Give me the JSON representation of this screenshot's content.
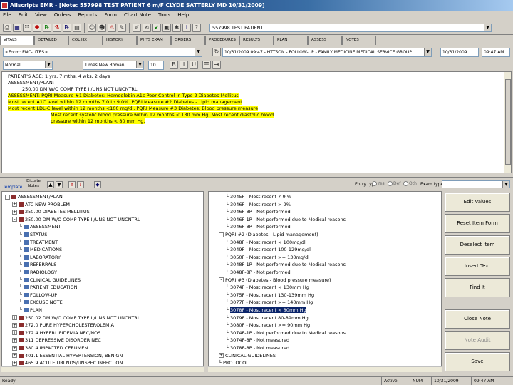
{
  "window": {
    "title": "Allscripts EMR - [Note: 557998 TEST PATIENT 6 m/F CLYDE SATTERLY MD 10/31/2009]"
  },
  "menu": [
    "File",
    "Edit",
    "View",
    "Orders",
    "Reports",
    "Form",
    "Chart Note",
    "Tools",
    "Help"
  ],
  "toolbar": {
    "patient_value": "557998 TEST PATIENT"
  },
  "tabs": [
    "VITALS",
    "DETAILED",
    "COL HX",
    "HISTORY",
    "PHYS EXAM",
    "ORDERS",
    "PROCEDURES",
    "RESULTS",
    "PLAN",
    "ASSESS",
    "NOTES"
  ],
  "note_header": {
    "form_value": "<Form: ENC-LITES>",
    "visit_value": "10/31/2009 09:47 - HTTSON - FOLLOW-UP - FAMILY MEDICINE MEDICAL SERVICE GROUP",
    "date_value": "10/31/2009",
    "time_value": "09:47 AM"
  },
  "format_bar": {
    "style_value": "Normal",
    "font_value": "Times New Roman",
    "size_value": "10"
  },
  "note_text": [
    {
      "text": "PATIENT'S AGE: 1 yrs, 7 mths, 4 wks, 2 days",
      "hl": false,
      "indent": 0
    },
    {
      "text": "ASSESSMENT/PLAN:",
      "hl": false,
      "indent": 0
    },
    {
      "text": "250.00 DM W/O COMP TYPE II/UNS NOT UNCNTRL",
      "hl": false,
      "indent": 20
    },
    {
      "text": "ASSESSMENT: PQRI Measure #1 Diabetes: Hemoglobin A1c Poor Control in Type 2 Diabetes Mellitus",
      "hl": true,
      "indent": 0
    },
    {
      "text": "Most recent A1C level within 12 months 7.0 to 9.0%. PQRI Measure #2 Diabetes - Lipid management",
      "hl": true,
      "indent": 0
    },
    {
      "text": "Most recent LDL-C level within 12 months <100 mg/dl. PQRI Measure #3 Diabetes: Blood pressure measure",
      "hl": true,
      "indent": 0
    },
    {
      "text": "Most recent systolic blood pressure within 12 months < 130 mm Hg. Most recent diastolic blood",
      "hl": true,
      "indent": 60
    },
    {
      "text": "pressure within 12 months < 80 mm Hg.",
      "hl": true,
      "indent": 60
    }
  ],
  "midbar": {
    "tab_templates": "Template",
    "tab_dictate": "Dictate Notes",
    "entry_type_label": "Entry type",
    "radio_1": "Yes",
    "radio_2": "Def",
    "radio_3": "Oth",
    "exam_label": "Exam type"
  },
  "left_tree": [
    {
      "text": "ASSESSMENT/PLAN",
      "level": 0,
      "exp": "-",
      "icon": "folder"
    },
    {
      "text": "ATC NEW PROBLEM",
      "level": 1,
      "exp": "+",
      "icon": "folder"
    },
    {
      "text": "250.00 DIABETES MELLITUS",
      "level": 1,
      "exp": "+",
      "icon": "folder"
    },
    {
      "text": "250.00 DM W/O COMP TYPE II/UNS NOT UNCNTRL",
      "level": 1,
      "exp": "-",
      "icon": "folder"
    },
    {
      "text": "ASSESSMENT",
      "level": 2,
      "exp": "",
      "icon": "doc"
    },
    {
      "text": "STATUS",
      "level": 2,
      "exp": "",
      "icon": "doc"
    },
    {
      "text": "TREATMENT",
      "level": 2,
      "exp": "",
      "icon": "doc"
    },
    {
      "text": "MEDICATIONS",
      "level": 2,
      "exp": "",
      "icon": "doc"
    },
    {
      "text": "LABORATORY",
      "level": 2,
      "exp": "",
      "icon": "doc"
    },
    {
      "text": "REFERRALS",
      "level": 2,
      "exp": "",
      "icon": "doc"
    },
    {
      "text": "RADIOLOGY",
      "level": 2,
      "exp": "",
      "icon": "doc"
    },
    {
      "text": "CLINICAL GUIDELINES",
      "level": 2,
      "exp": "",
      "icon": "doc"
    },
    {
      "text": "PATIENT EDUCATION",
      "level": 2,
      "exp": "",
      "icon": "doc"
    },
    {
      "text": "FOLLOW-UP",
      "level": 2,
      "exp": "",
      "icon": "doc"
    },
    {
      "text": "EXCUSE NOTE",
      "level": 2,
      "exp": "",
      "icon": "doc"
    },
    {
      "text": "PLAN",
      "level": 2,
      "exp": "",
      "icon": "doc"
    },
    {
      "text": "250.02 DM W/O COMP TYPE II/UNS NOT UNCNTRL",
      "level": 1,
      "exp": "+",
      "icon": "folder"
    },
    {
      "text": "272.0 PURE HYPERCHOLESTEROLEMIA",
      "level": 1,
      "exp": "+",
      "icon": "folder"
    },
    {
      "text": "272.4 HYPERLIPIDEMIA NEC/NOS",
      "level": 1,
      "exp": "+",
      "icon": "folder"
    },
    {
      "text": "311 DEPRESSIVE DISORDER NEC",
      "level": 1,
      "exp": "+",
      "icon": "folder"
    },
    {
      "text": "380.4 IMPACTED CERUMEN",
      "level": 1,
      "exp": "+",
      "icon": "folder"
    },
    {
      "text": "401.1 ESSENTIAL HYPERTENSION, BENIGN",
      "level": 1,
      "exp": "+",
      "icon": "folder"
    },
    {
      "text": "465.9 ACUTE URI NOS/UNSPEC INFECTION",
      "level": 1,
      "exp": "+",
      "icon": "folder"
    }
  ],
  "mid_tree": [
    {
      "text": "3045F - Most recent 7-9 %",
      "level": 2,
      "exp": "",
      "sel": false
    },
    {
      "text": "3046F - Most recent > 9%",
      "level": 2,
      "exp": "",
      "sel": false
    },
    {
      "text": "3046F-8P - Not performed",
      "level": 2,
      "exp": "",
      "sel": false
    },
    {
      "text": "3046F-1P - Not performed due to Medical reasons",
      "level": 2,
      "exp": "",
      "sel": false
    },
    {
      "text": "3046F-8P - Not performed",
      "level": 2,
      "exp": "",
      "sel": false
    },
    {
      "text": "PQRI #2 (Diabetes - Lipid management)",
      "level": 1,
      "exp": "-",
      "sel": false
    },
    {
      "text": "3048F - Most recent < 100mg/dl",
      "level": 2,
      "exp": "",
      "sel": false
    },
    {
      "text": "3049F - Most recent 100-129mg/dl",
      "level": 2,
      "exp": "",
      "sel": false
    },
    {
      "text": "3050F - Most recent >= 130mg/dl",
      "level": 2,
      "exp": "",
      "sel": false
    },
    {
      "text": "3048F-1P - Not performed due to Medical reasons",
      "level": 2,
      "exp": "",
      "sel": false
    },
    {
      "text": "3048F-8P - Not performed",
      "level": 2,
      "exp": "",
      "sel": false
    },
    {
      "text": "PQRI #3 (Diabetes - Blood pressure measure)",
      "level": 1,
      "exp": "-",
      "sel": false
    },
    {
      "text": "3074F - Most recent < 130mm Hg",
      "level": 2,
      "exp": "",
      "sel": false
    },
    {
      "text": "3075F - Most recent 130-139mm Hg",
      "level": 2,
      "exp": "",
      "sel": false
    },
    {
      "text": "3077F - Most recent >= 140mm Hg",
      "level": 2,
      "exp": "",
      "sel": false
    },
    {
      "text": "3078F - Most recent < 80mm Hg",
      "level": 2,
      "exp": "",
      "sel": true
    },
    {
      "text": "3079F - Most recent 80-89mm Hg",
      "level": 2,
      "exp": "",
      "sel": false
    },
    {
      "text": "3080F - Most recent >= 90mm Hg",
      "level": 2,
      "exp": "",
      "sel": false
    },
    {
      "text": "3074F-1P - Not performed due to Medical reasons",
      "level": 2,
      "exp": "",
      "sel": false
    },
    {
      "text": "3074F-8P - Not measured",
      "level": 2,
      "exp": "",
      "sel": false
    },
    {
      "text": "3078F-8P - Not measured",
      "level": 2,
      "exp": "",
      "sel": false
    },
    {
      "text": "CLINICAL GUIDELINES",
      "level": 1,
      "exp": "+",
      "sel": false
    },
    {
      "text": "PROTOCOL",
      "level": 1,
      "exp": "",
      "sel": false
    }
  ],
  "buttons": [
    {
      "label": "Edit Values",
      "disabled": false
    },
    {
      "label": "Reset Item Form",
      "disabled": false
    },
    {
      "label": "Deselect Item",
      "disabled": false
    },
    {
      "label": "Insert Text",
      "disabled": false
    },
    {
      "label": "Find It",
      "disabled": false
    },
    {
      "label": "Close Note",
      "disabled": false
    },
    {
      "label": "Note Audit",
      "disabled": true
    },
    {
      "label": "Save",
      "disabled": false
    }
  ],
  "status": {
    "ready": "Ready",
    "mode": "Active",
    "num": "NUM",
    "date": "10/31/2009",
    "time": "09:47 AM"
  }
}
